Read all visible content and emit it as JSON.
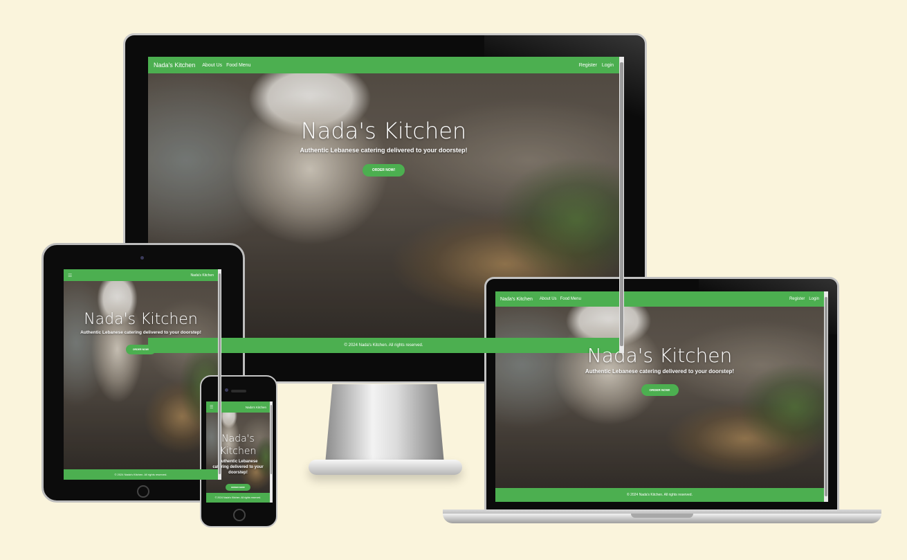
{
  "site": {
    "brand": "Nada's Kitchen",
    "nav_links": [
      "About Us",
      "Food Menu"
    ],
    "auth_links": [
      "Register",
      "Login"
    ],
    "hero_title": "Nada's Kitchen",
    "hero_subtitle": "Authentic Lebanese catering delivered to your doorstep!",
    "order_button": "ORDER NOW!",
    "footer": "© 2024 Nada's Kitchen. All rights reserved.",
    "menu_icon": "hamburger-menu-icon"
  },
  "colors": {
    "background": "#faf4dc",
    "brand_green": "#4caf50"
  }
}
